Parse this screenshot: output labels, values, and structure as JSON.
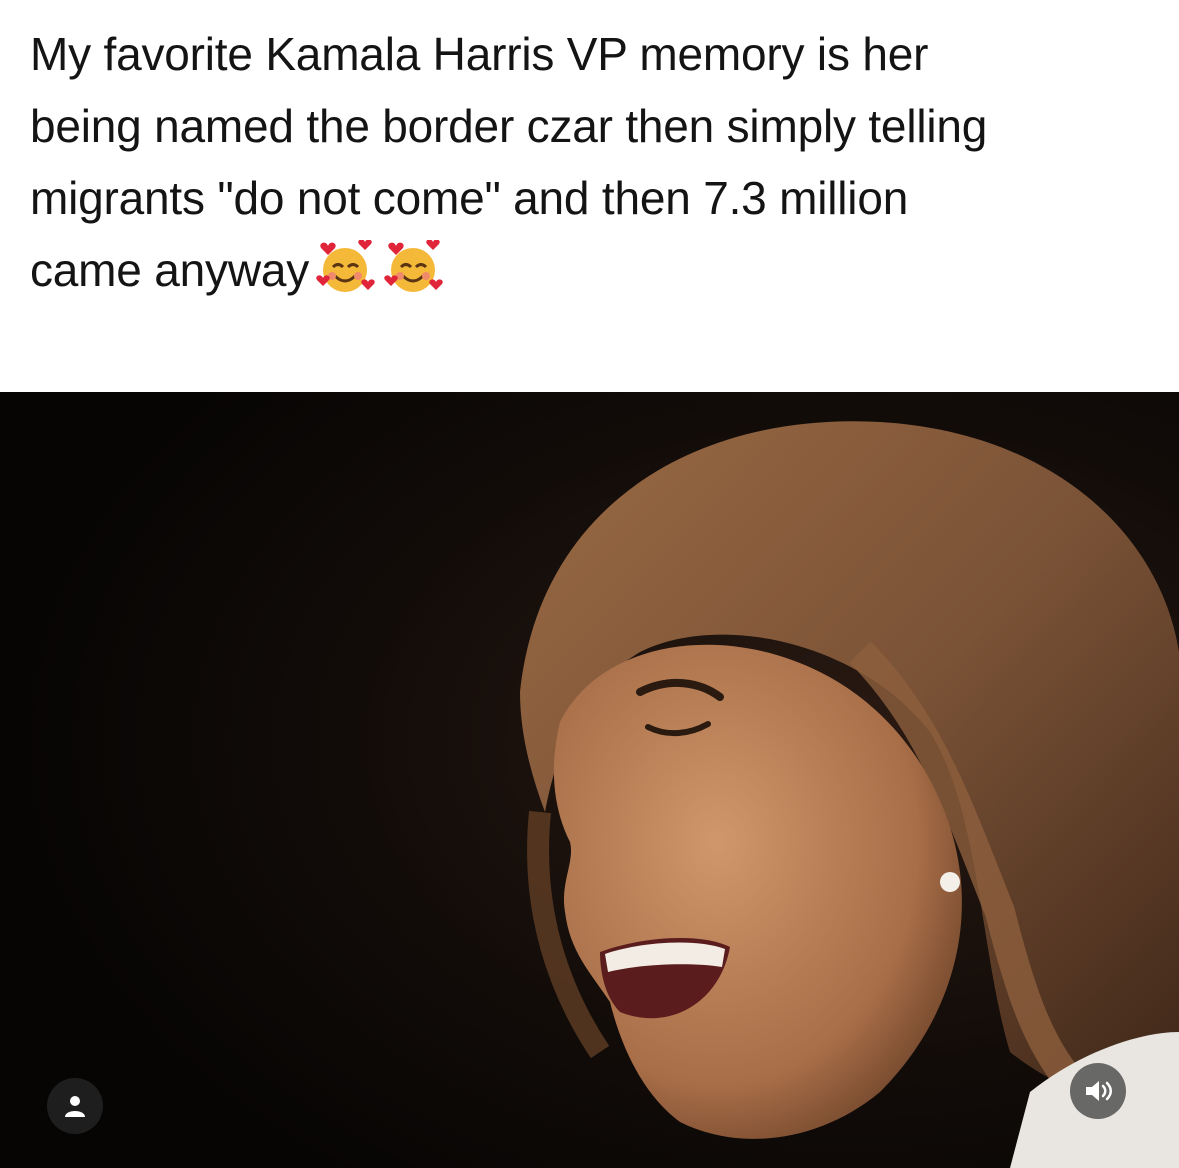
{
  "post": {
    "caption_lines": [
      "My favorite Kamala Harris VP memory is her",
      "being named the border czar then simply telling",
      "migrants \"do not come\" and then 7.3 million",
      "came anyway"
    ],
    "caption_emojis": [
      "smiling-face-with-hearts",
      "smiling-face-with-hearts"
    ]
  },
  "media": {
    "type": "video",
    "subject": "laughing-woman-photo"
  },
  "controls": {
    "tag_icon": "user-icon",
    "sound_icon": "speaker-icon"
  },
  "colors": {
    "caption_text": "#141414",
    "photo_background": "#0a0706",
    "hair": "#7a5236",
    "skin": "#b57d55"
  }
}
